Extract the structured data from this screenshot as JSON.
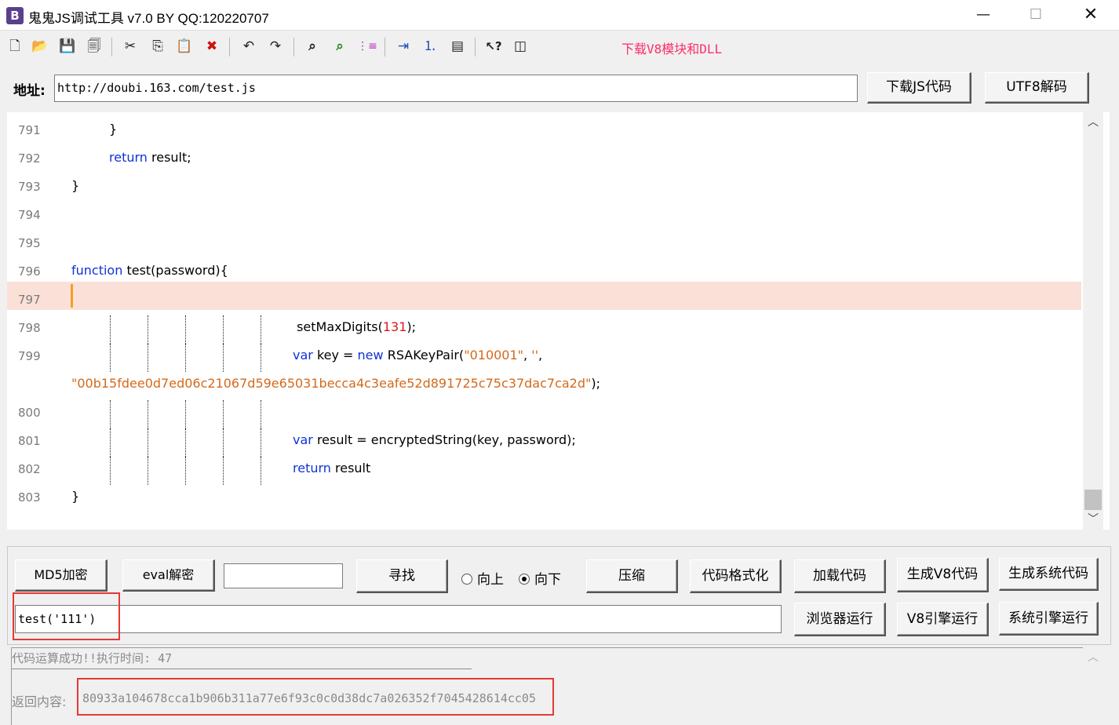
{
  "window": {
    "icon_letter": "B",
    "title": "鬼鬼JS调试工具 v7.0 BY QQ:120220707",
    "minimize": "—",
    "maximize": "☐",
    "close": "✕"
  },
  "toolbar": {
    "icons": [
      "new-file-icon",
      "open-folder-icon",
      "save-icon",
      "save-all-icon",
      "cut-icon",
      "copy-icon",
      "paste-icon",
      "delete-icon",
      "undo-icon",
      "redo-icon",
      "find-icon",
      "find-next-icon",
      "list-icon",
      "indent-icon",
      "numbered-list-icon",
      "window-icon",
      "help-cursor-icon",
      "panel-icon"
    ],
    "glyphs": {
      "new": "🗋",
      "open": "📂",
      "save": "💾",
      "save_all": "🗐",
      "cut": "✂",
      "copy": "⎘",
      "paste": "📋",
      "delete": "✖",
      "undo": "↶",
      "redo": "↷",
      "find": "⌕",
      "find_next": "⌕",
      "list": "⋮≡",
      "indent": "⇥",
      "numbered": "⒈",
      "window": "▤",
      "help": "↖?",
      "panel": "◫"
    },
    "download_link": "下载V8模块和DLL"
  },
  "address": {
    "label": "地址:",
    "value": "http://doubi.163.com/test.js",
    "download_button": "下载JS代码",
    "utf8_button": "UTF8解码"
  },
  "editor": {
    "lines": [
      {
        "num": "791",
        "code": "}"
      },
      {
        "num": "792",
        "kw": "return",
        "code": " result;"
      },
      {
        "num": "793",
        "code": "}"
      },
      {
        "num": "794",
        "code": ""
      },
      {
        "num": "795",
        "code": ""
      },
      {
        "num": "796",
        "kw": "function",
        "code": " test(password){"
      },
      {
        "num": "797",
        "code": ""
      },
      {
        "num": "798",
        "pre": " setMaxDigits(",
        "n": "131",
        "post": ");"
      },
      {
        "num": "799",
        "kw": "var",
        "mid": " key = ",
        "kw2": "new",
        "pre": " RSAKeyPair(",
        "s1": "\"010001\"",
        "sep": ", ",
        "s2": "''",
        "post": ","
      },
      {
        "num": "",
        "s3": "\"00b15fdee0d7ed06c21067d59e65031becca4c3eafe52d891725c75c37dac7ca2d\"",
        "post": ");"
      },
      {
        "num": "800",
        "code": ""
      },
      {
        "num": "801",
        "kw": "var",
        "code": " result = encryptedString(key, password);"
      },
      {
        "num": "802",
        "kw": "return",
        "code": " result"
      },
      {
        "num": "803",
        "code": "}"
      }
    ],
    "highlight_color": "#fbe0d8",
    "scroll_up": "︿",
    "scroll_down": "﹀"
  },
  "controls": {
    "md5_button": "MD5加密",
    "eval_button": "eval解密",
    "search_value": "",
    "find_button": "寻找",
    "radio_up": "向上",
    "radio_down": "向下",
    "radio_selected": "向下",
    "compress_button": "压缩",
    "format_button": "代码格式化",
    "load_button": "加载代码",
    "gen_v8_button": "生成V8代码",
    "gen_sys_button": "生成系统代码",
    "command_value": "test('111')",
    "browser_run_button": "浏览器运行",
    "v8_run_button": "V8引擎运行",
    "sys_run_button": "系统引擎运行"
  },
  "result": {
    "status": "代码运算成功!!执行时间: 47",
    "label": "返回内容:",
    "value": "80933a104678cca1b906b311a77e6f93c0c0d38dc7a026352f7045428614cc05"
  },
  "colors": {
    "keyword": "#1033d6",
    "string": "#d4691a",
    "number": "#e0151b",
    "download_link": "#ff2d6b",
    "annotation_box": "#e53935"
  }
}
